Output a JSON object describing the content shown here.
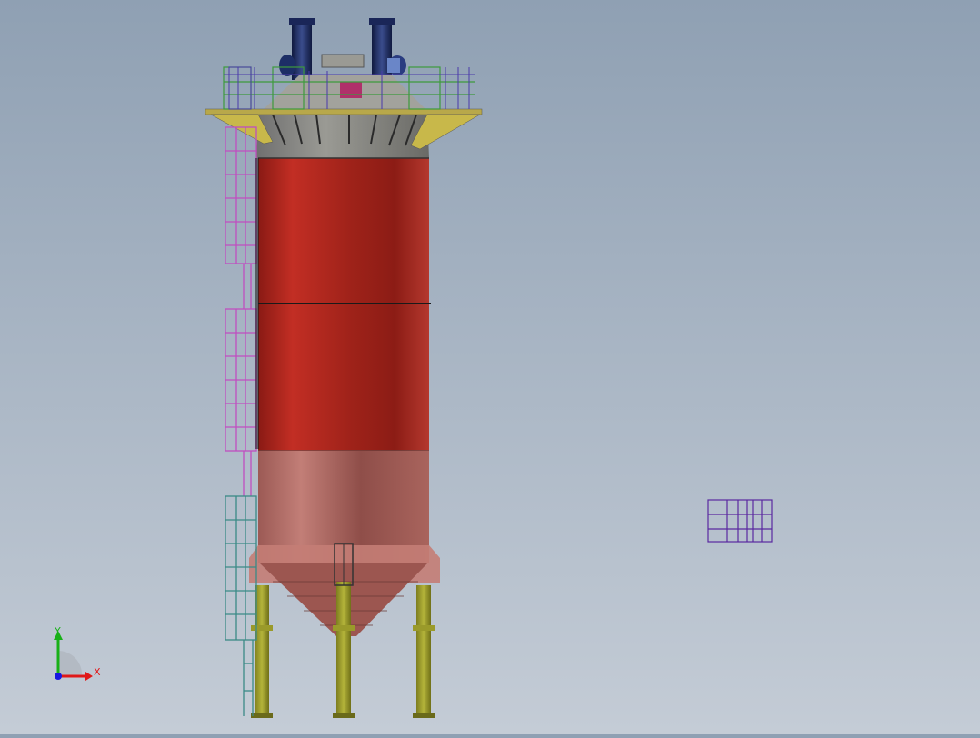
{
  "view": {
    "background_top": "#8fa0b3",
    "background_bottom": "#c4ccd6"
  },
  "model": {
    "body_color": "#b42a22",
    "hopper_color": "#b97670",
    "roof_color": "#8a8a86",
    "leg_color": "#a3a32a",
    "ladder_color": "#c04ec0",
    "lower_ladder_color": "#3a8a86",
    "rail_color": "#3d9a3d",
    "pipe_color": "#1d2e66"
  },
  "triad": {
    "x_label": "X",
    "y_label": "Y",
    "x_color": "#e01818",
    "y_color": "#18b018",
    "z_color": "#1818e0"
  }
}
